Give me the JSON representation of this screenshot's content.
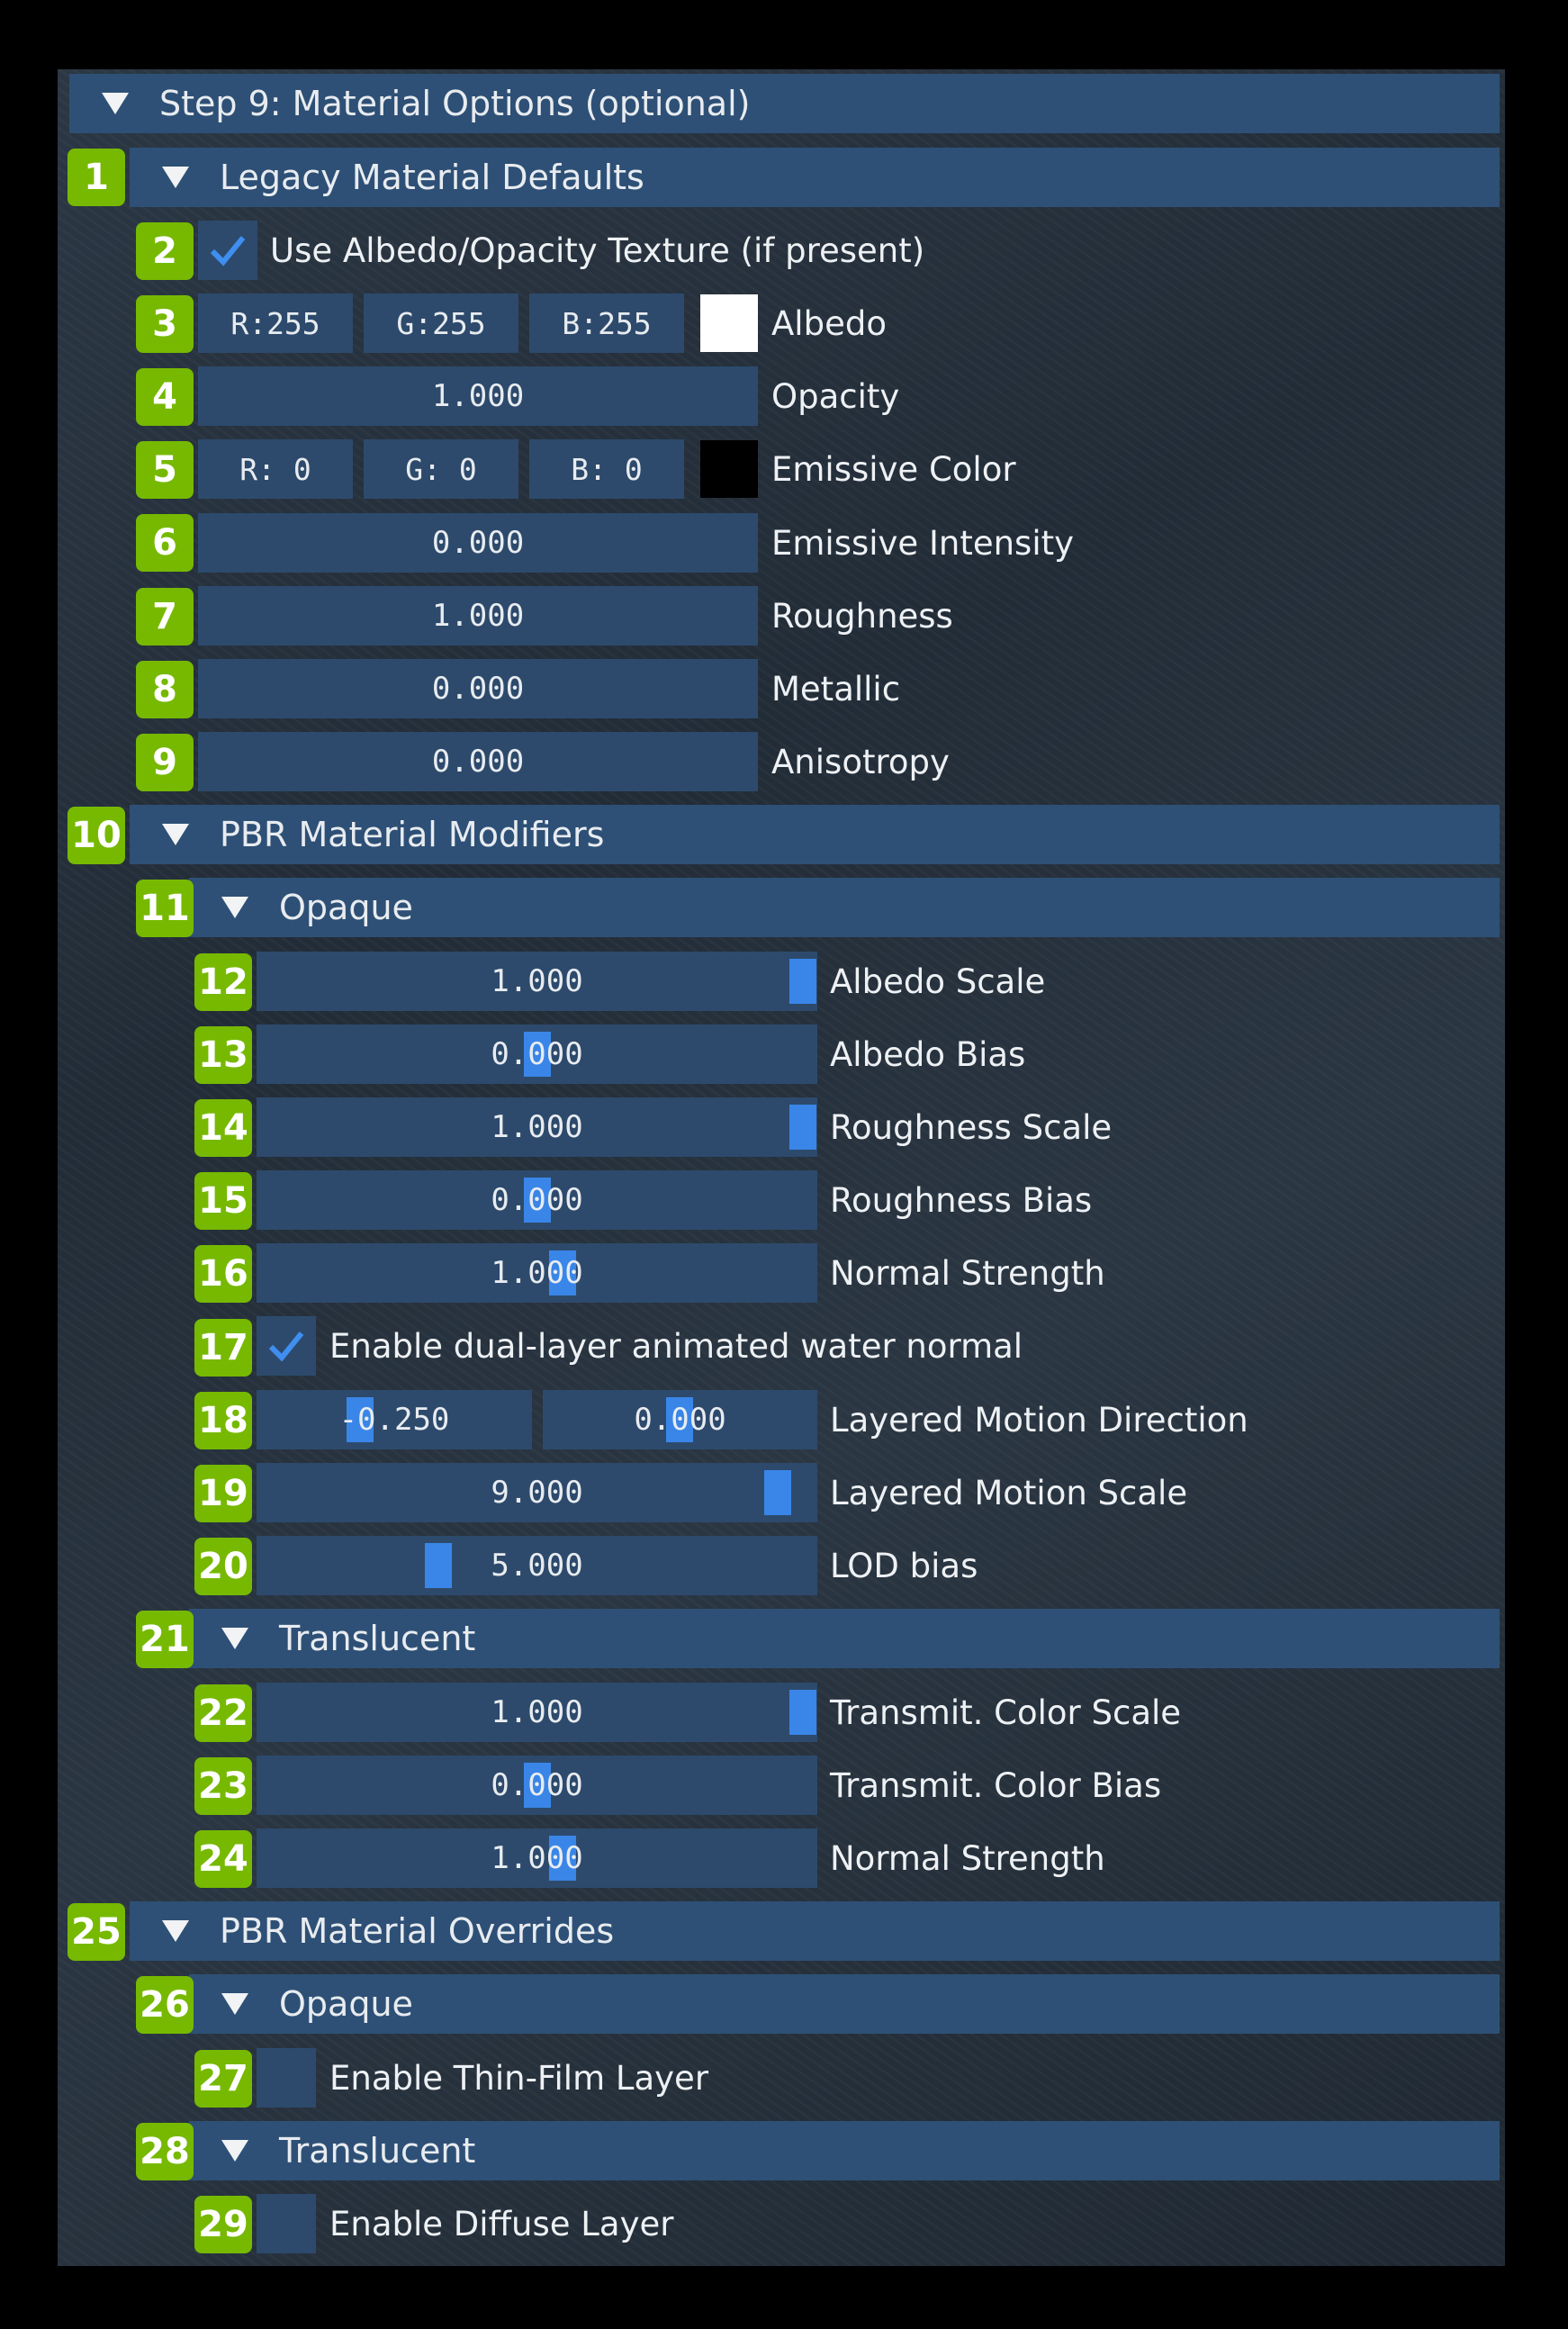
{
  "panel": {
    "title": "Step 9: Material Options (optional)"
  },
  "legacy": {
    "header": "Legacy Material Defaults",
    "use_texture_label": "Use Albedo/Opacity Texture (if present)",
    "use_texture_checked": true,
    "albedo": {
      "r": "R:255",
      "g": "G:255",
      "b": "B:255",
      "swatch_color": "#ffffff",
      "label": "Albedo"
    },
    "opacity": {
      "value": "1.000",
      "label": "Opacity"
    },
    "emissive": {
      "r": "R: 0",
      "g": "G: 0",
      "b": "B: 0",
      "swatch_color": "#000000",
      "label": "Emissive Color"
    },
    "emissive_intensity": {
      "value": "0.000",
      "label": "Emissive Intensity"
    },
    "roughness": {
      "value": "1.000",
      "label": "Roughness"
    },
    "metallic": {
      "value": "0.000",
      "label": "Metallic"
    },
    "anisotropy": {
      "value": "0.000",
      "label": "Anisotropy"
    }
  },
  "modifiers": {
    "header": "PBR Material Modifiers",
    "opaque": {
      "header": "Opaque",
      "albedo_scale": {
        "value": "1.000",
        "label": "Albedo Scale"
      },
      "albedo_bias": {
        "value": "0.000",
        "label": "Albedo Bias"
      },
      "roughness_scale": {
        "value": "1.000",
        "label": "Roughness Scale"
      },
      "roughness_bias": {
        "value": "0.000",
        "label": "Roughness Bias"
      },
      "normal_strength": {
        "value": "1.000",
        "label": "Normal Strength"
      },
      "water_normal_label": "Enable dual-layer animated water normal",
      "water_normal_checked": true,
      "motion_direction": {
        "x": "-0.250",
        "y": "0.000",
        "label": "Layered Motion Direction"
      },
      "motion_scale": {
        "value": "9.000",
        "label": "Layered Motion Scale"
      },
      "lod_bias": {
        "value": "5.000",
        "label": "LOD bias"
      }
    },
    "translucent": {
      "header": "Translucent",
      "color_scale": {
        "value": "1.000",
        "label": "Transmit. Color Scale"
      },
      "color_bias": {
        "value": "0.000",
        "label": "Transmit. Color Bias"
      },
      "normal_strength": {
        "value": "1.000",
        "label": "Normal Strength"
      }
    }
  },
  "overrides": {
    "header": "PBR Material Overrides",
    "opaque": {
      "header": "Opaque",
      "thin_film_label": "Enable Thin-Film Layer",
      "thin_film_checked": false
    },
    "translucent": {
      "header": "Translucent",
      "diffuse_label": "Enable Diffuse Layer",
      "diffuse_checked": false
    }
  },
  "badges": [
    "1",
    "2",
    "3",
    "4",
    "5",
    "6",
    "7",
    "8",
    "9",
    "10",
    "11",
    "12",
    "13",
    "14",
    "15",
    "16",
    "17",
    "18",
    "19",
    "20",
    "21",
    "22",
    "23",
    "24",
    "25",
    "26",
    "27",
    "28",
    "29"
  ],
  "colors": {
    "accent": "#76b900",
    "header_bg": "#2e5076",
    "field_bg": "#2d4a6c",
    "grab": "#3a86e8"
  }
}
